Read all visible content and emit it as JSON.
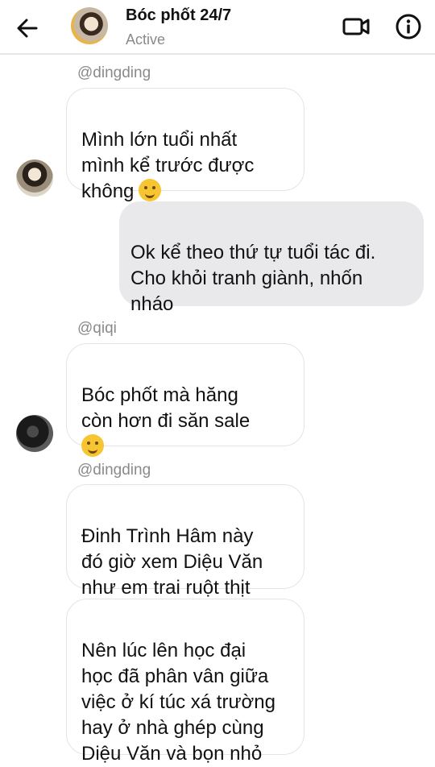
{
  "header": {
    "back_icon": "back-arrow-icon",
    "title": "Bóc phốt 24/7",
    "status": "Active",
    "video_icon": "video-camera-icon",
    "info_icon": "info-icon"
  },
  "messages": [
    {
      "sender": "@dingding",
      "text": "Mình lớn tuổi nhất\nmình kể trước được\nkhông",
      "emoji": "smiling-face-with-tear-emoji"
    },
    {
      "text": "Ok kể theo thứ tự tuổi tác đi.\nCho khỏi tranh giành, nhốn\nnháo"
    },
    {
      "sender": "@qiqi",
      "text": "Bóc phốt mà hăng\ncòn hơn đi săn sale\n",
      "emoji": "face-with-tears-of-joy-emoji"
    },
    {
      "sender": "@dingding",
      "text": "Đinh Trình Hâm này\nđó giờ xem Diệu Văn\nnhư em trai ruột thịt"
    },
    {
      "text": "Nên lúc lên học đại\nhọc đã phân vân giữa\nviệc ở kí túc xá trường\nhay ở nhà ghép cùng\nDiệu Văn và bọn nhỏ"
    }
  ],
  "colors": {
    "outgoing_bubble": "#e9e9eb",
    "incoming_border": "#e4e4e4",
    "muted_text": "#8a8a8a"
  }
}
